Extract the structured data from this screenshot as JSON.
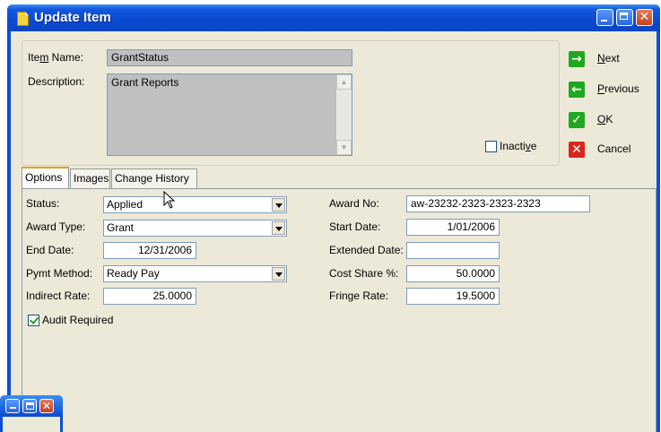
{
  "window": {
    "title": "Update Item",
    "controls": {
      "minimize": "minimize-icon",
      "maximize": "maximize-icon",
      "close": "close-icon"
    }
  },
  "item": {
    "name_label_pre": "Ite",
    "name_label_u": "m",
    "name_label_post": " Name:",
    "name_value": "GrantStatus",
    "description_label": "Description:",
    "description_value": "Grant Reports",
    "inactive_label_pre": "Inacti",
    "inactive_label_u": "v",
    "inactive_label_post": "e"
  },
  "actions": {
    "next": {
      "u": "N",
      "rest": "ext",
      "icon": "arrow-right-icon",
      "color": "#1fa81f"
    },
    "previous": {
      "u": "P",
      "rest": "revious",
      "icon": "arrow-left-icon",
      "color": "#1fa81f"
    },
    "ok": {
      "u": "O",
      "rest": "K",
      "icon": "checkmark-icon",
      "color": "#1fa81f"
    },
    "cancel": {
      "label": "Cancel",
      "icon": "x-icon",
      "color": "#d9261c"
    }
  },
  "tabs": [
    {
      "label": "Options"
    },
    {
      "label": "Images"
    },
    {
      "label": "Change History"
    }
  ],
  "options": {
    "status_label": "Status:",
    "status_value": "Applied",
    "award_type_label": "Award Type:",
    "award_type_value": "Grant",
    "end_date_label": "End Date:",
    "end_date_value": "12/31/2006",
    "pymt_method_label": "Pymt Method:",
    "pymt_method_value": "Ready Pay",
    "indirect_rate_label": "Indirect Rate:",
    "indirect_rate_value": "25.0000",
    "audit_required_label": "Audit Required",
    "award_no_label": "Award No:",
    "award_no_value": "aw-23232-2323-2323-2323",
    "start_date_label": "Start Date:",
    "start_date_value": "1/01/2006",
    "extended_date_label": "Extended Date:",
    "extended_date_value": "",
    "cost_share_label": "Cost Share %:",
    "cost_share_value": "50.0000",
    "fringe_rate_label": "Fringe Rate:",
    "fringe_rate_value": "19.5000"
  }
}
